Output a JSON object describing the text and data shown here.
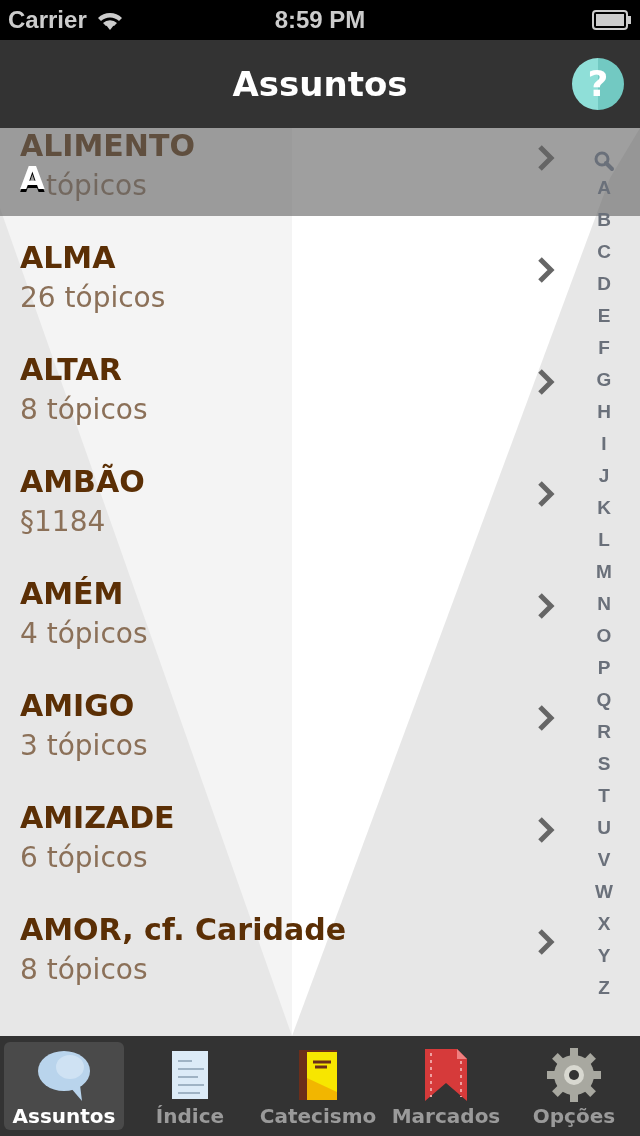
{
  "status_bar": {
    "carrier": "Carrier",
    "time": "8:59 PM"
  },
  "nav": {
    "title": "Assuntos",
    "help_label": "?"
  },
  "section_header": {
    "label": "A"
  },
  "rows": [
    {
      "title": "ALIMENTO",
      "subtitle": "tópicos",
      "covered": true
    },
    {
      "title": "ALMA",
      "subtitle": "26 tópicos"
    },
    {
      "title": "ALTAR",
      "subtitle": "8 tópicos"
    },
    {
      "title": "AMBÃO",
      "subtitle": "§1184"
    },
    {
      "title": "AMÉM",
      "subtitle": "4 tópicos"
    },
    {
      "title": "AMIGO",
      "subtitle": "3 tópicos"
    },
    {
      "title": "AMIZADE",
      "subtitle": "6 tópicos"
    },
    {
      "title": "AMOR, cf. Caridade",
      "subtitle": "8 tópicos"
    }
  ],
  "index": [
    "A",
    "B",
    "C",
    "D",
    "E",
    "F",
    "G",
    "H",
    "I",
    "J",
    "K",
    "L",
    "M",
    "N",
    "O",
    "P",
    "Q",
    "R",
    "S",
    "T",
    "U",
    "V",
    "W",
    "X",
    "Y",
    "Z"
  ],
  "tabs": [
    {
      "label": "Assuntos",
      "selected": true
    },
    {
      "label": "Índice",
      "selected": false
    },
    {
      "label": "Catecismo",
      "selected": false
    },
    {
      "label": "Marcados",
      "selected": false
    },
    {
      "label": "Opções",
      "selected": false
    }
  ]
}
